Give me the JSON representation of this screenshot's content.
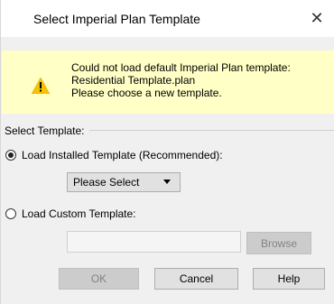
{
  "window": {
    "title": "Select Imperial Plan Template",
    "close_label": "✕"
  },
  "warning": {
    "lines": [
      "Could not load default Imperial Plan template:",
      "Residential Template.plan",
      "Please choose a new template."
    ],
    "icon": "warning-triangle-icon",
    "background": "#ffffc6"
  },
  "form": {
    "section_label": "Select Template:",
    "option_installed": {
      "label": "Load Installed Template (Recommended):",
      "selected": true
    },
    "template_select": {
      "value": "Please Select"
    },
    "option_custom": {
      "label": "Load Custom Template:",
      "selected": false
    },
    "custom_path": {
      "value": ""
    },
    "browse_label": "Browse"
  },
  "buttons": {
    "ok": "OK",
    "cancel": "Cancel",
    "help": "Help"
  }
}
